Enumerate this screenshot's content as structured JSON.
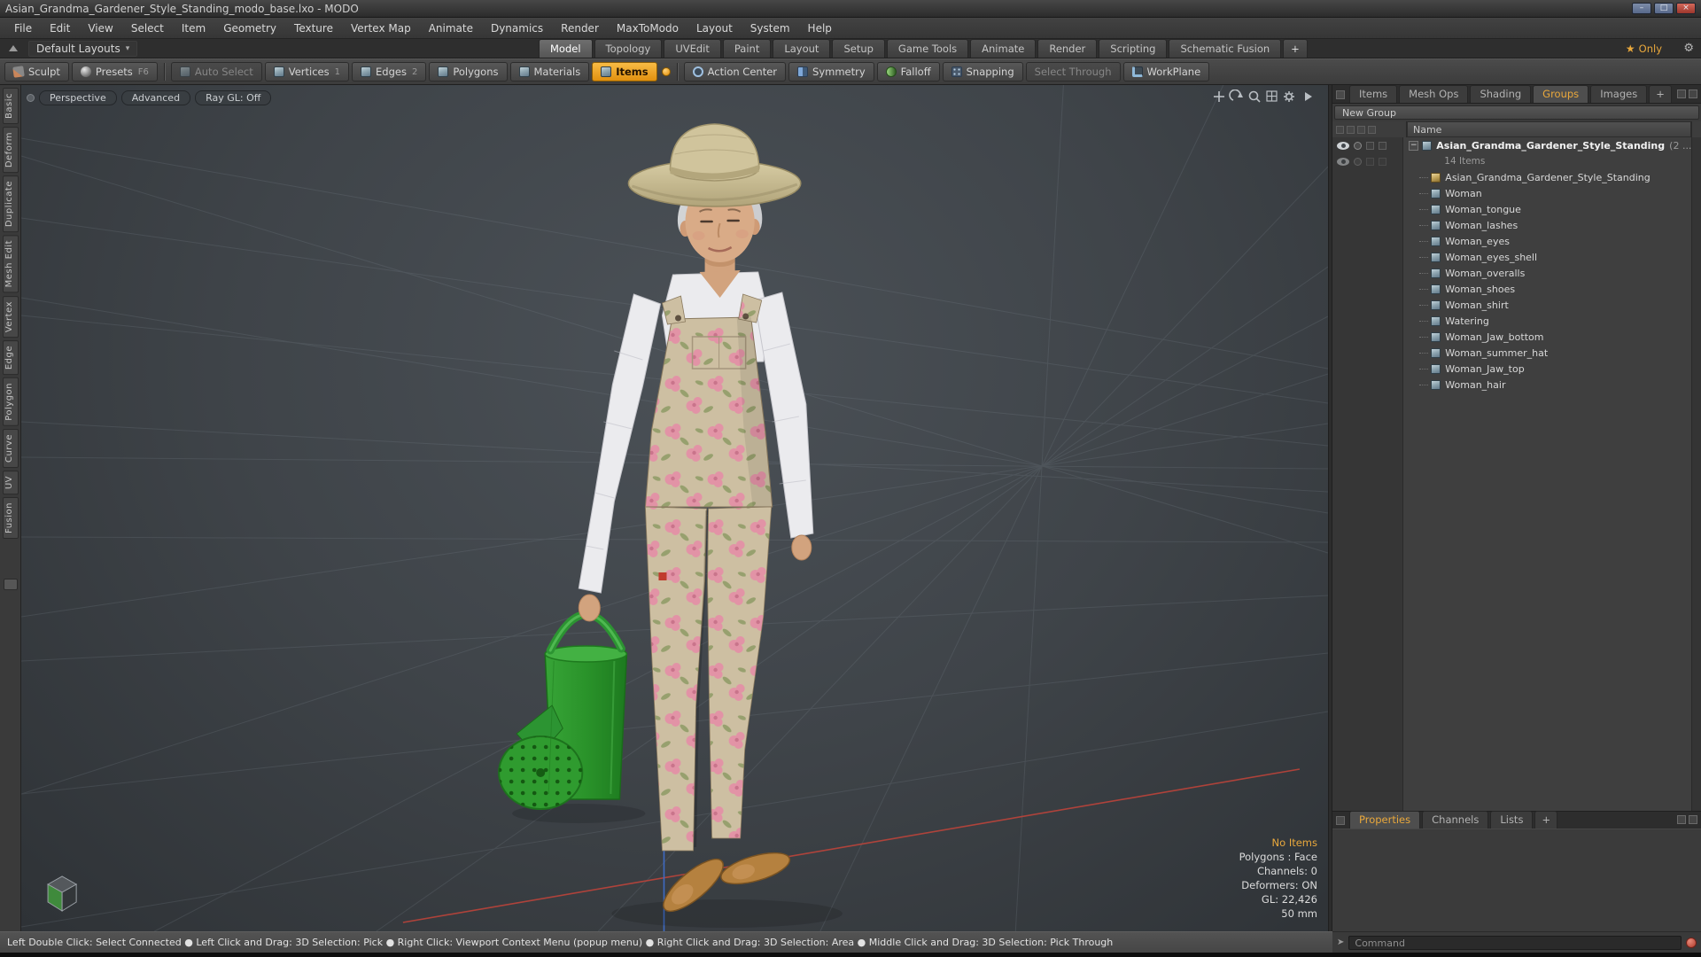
{
  "window": {
    "title": "Asian_Grandma_Gardener_Style_Standing_modo_base.lxo - MODO",
    "minimize_glyph": "–",
    "maximize_glyph": "□",
    "close_glyph": "×"
  },
  "menu": {
    "items": [
      "File",
      "Edit",
      "View",
      "Select",
      "Item",
      "Geometry",
      "Texture",
      "Vertex Map",
      "Animate",
      "Dynamics",
      "Render",
      "MaxToModo",
      "Layout",
      "System",
      "Help"
    ]
  },
  "layout_bar": {
    "layouts_label": "Default Layouts",
    "caret": "▾",
    "tabs": [
      "Model",
      "Topology",
      "UVEdit",
      "Paint",
      "Layout",
      "Setup",
      "Game Tools",
      "Animate",
      "Render",
      "Scripting",
      "Schematic Fusion"
    ],
    "add_tab": "+",
    "star": "★",
    "only_label": "Only",
    "gear": "⚙"
  },
  "toolbar": {
    "sculpt": "Sculpt",
    "presets": "Presets",
    "presets_key": "F6",
    "auto_select": "Auto Select",
    "vertices": "Vertices",
    "vertices_key": "1",
    "edges": "Edges",
    "edges_key": "2",
    "polygons": "Polygons",
    "materials": "Materials",
    "items": "Items",
    "action_center": "Action Center",
    "symmetry": "Symmetry",
    "falloff": "Falloff",
    "snapping": "Snapping",
    "select_through": "Select Through",
    "workplane": "WorkPlane"
  },
  "left_tabs": [
    "Basic",
    "Deform",
    "Duplicate",
    "Mesh Edit",
    "Vertex",
    "Edge",
    "Polygon",
    "Curve",
    "UV",
    "Fusion"
  ],
  "viewport": {
    "mode_buttons": [
      "Perspective",
      "Advanced",
      "Ray GL: Off"
    ],
    "info": {
      "line1": "No Items",
      "line2": "Polygons : Face",
      "line3": "Channels: 0",
      "line4": "Deformers: ON",
      "line5": "GL: 22,426",
      "line6": "50 mm"
    }
  },
  "right_panel": {
    "tabs": [
      "Items",
      "Mesh Ops",
      "Shading",
      "Groups",
      "Images"
    ],
    "add_tab": "+",
    "new_group_label": "New Group",
    "name_header": "Name",
    "group_name": "Asian_Grandma_Gardener_Style_Standing",
    "group_suffix": "(2 ...",
    "group_count": "14 Items",
    "items": [
      "Asian_Grandma_Gardener_Style_Standing",
      "Woman",
      "Woman_tongue",
      "Woman_lashes",
      "Woman_eyes",
      "Woman_eyes_shell",
      "Woman_overalls",
      "Woman_shoes",
      "Woman_shirt",
      "Watering",
      "Woman_Jaw_bottom",
      "Woman_summer_hat",
      "Woman_Jaw_top",
      "Woman_hair"
    ],
    "expander_glyph": "−"
  },
  "bottom_panel": {
    "tabs": [
      "Properties",
      "Channels",
      "Lists"
    ],
    "add_tab": "+"
  },
  "command": {
    "prompt": "➤",
    "placeholder": "Command"
  },
  "status_bar": {
    "text": "Left Double Click: Select Connected   ●   Left Click and Drag: 3D Selection: Pick   ●   Right Click: Viewport Context Menu (popup menu)   ●   Right Click and Drag: 3D Selection: Area   ●   Middle Click and Drag: 3D Selection: Pick Through"
  },
  "colors": {
    "accent_orange": "#e9a83c",
    "items_button": "#f0a32a",
    "can_green": "#2f9b2f"
  }
}
